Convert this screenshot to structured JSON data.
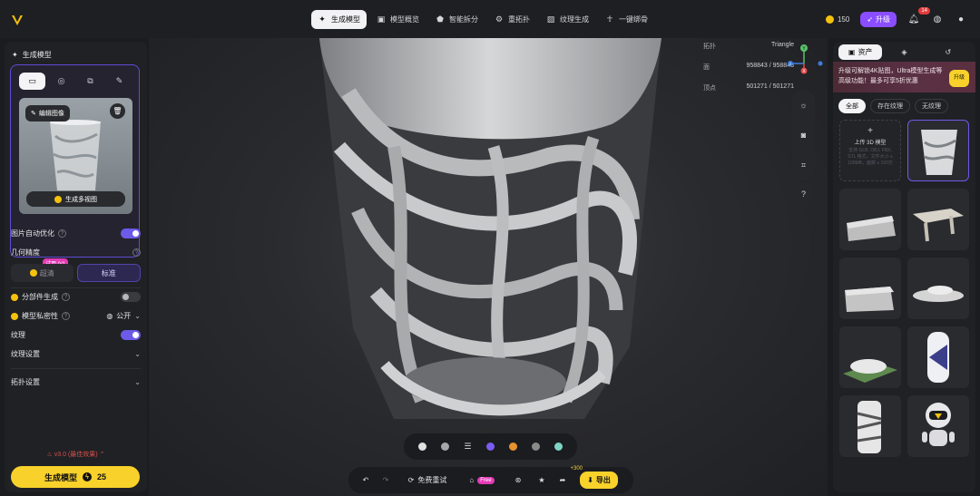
{
  "topbar": {
    "tabs": [
      {
        "label": "生成模型",
        "icon": "sparkle-icon",
        "active": true
      },
      {
        "label": "模型概览",
        "icon": "cube-icon",
        "active": false
      },
      {
        "label": "智能拆分",
        "icon": "split-icon",
        "active": false
      },
      {
        "label": "重拓扑",
        "icon": "topology-icon",
        "active": false
      },
      {
        "label": "纹理生成",
        "icon": "texture-icon",
        "active": false
      },
      {
        "label": "一键绑骨",
        "icon": "rig-icon",
        "active": false
      }
    ],
    "credits": "150",
    "upgrade_label": "升级",
    "notification_count": "14"
  },
  "left_panel": {
    "title": "生成模型",
    "edit_image_label": "编辑图像",
    "multi_view_label": "生成多视图",
    "auto_optimize_label": "图片自动优化",
    "auto_optimize_on": true,
    "geometry_precision_label": "几何精度",
    "trial_badge": "试用 0/1",
    "precision_options": [
      "超清",
      "标准"
    ],
    "precision_selected": "标准",
    "part_gen_label": "分部件生成",
    "part_gen_on": false,
    "privacy_label": "模型私密性",
    "privacy_value": "公开",
    "texture_label": "纹理",
    "texture_on": true,
    "texture_settings_label": "纹理设置",
    "topology_settings_label": "拓扑设置",
    "version_label": "v3.0 (最佳效果)",
    "generate_label": "生成模型",
    "generate_cost": "25"
  },
  "viewport": {
    "stats": [
      {
        "key": "拓扑",
        "value": "Triangle"
      },
      {
        "key": "面",
        "value": "958843 / 958843"
      },
      {
        "key": "顶点",
        "value": "501271 / 501271"
      }
    ],
    "gizmo_axes": [
      "Y",
      "X",
      "Z"
    ],
    "help_label": "?",
    "bottom": {
      "free_retry_label": "免费重试",
      "free_badge": "Free",
      "points_label": "+300",
      "export_label": "导出"
    },
    "material_colors": [
      "#d9d9d9",
      "#bfbfbf",
      "#7b5cf0",
      "#e6922e",
      "#8a8a8a",
      "#7fd4c4"
    ]
  },
  "right_panel": {
    "tabs": [
      "资产",
      "",
      ""
    ],
    "promo_text": "升级可解锁4K贴图，Ultra模型生成等高级功能！最多可享5折优惠",
    "promo_button": "升级",
    "filters": [
      "全部",
      "存在纹理",
      "无纹理"
    ],
    "upload_title": "上传 3D 模型",
    "upload_hint": "支持 GLB, OBJ, FBX, STL 格式，文件大小 ≤ 100MB，面数 ≤ 100万",
    "thumbnail_count": 9
  }
}
